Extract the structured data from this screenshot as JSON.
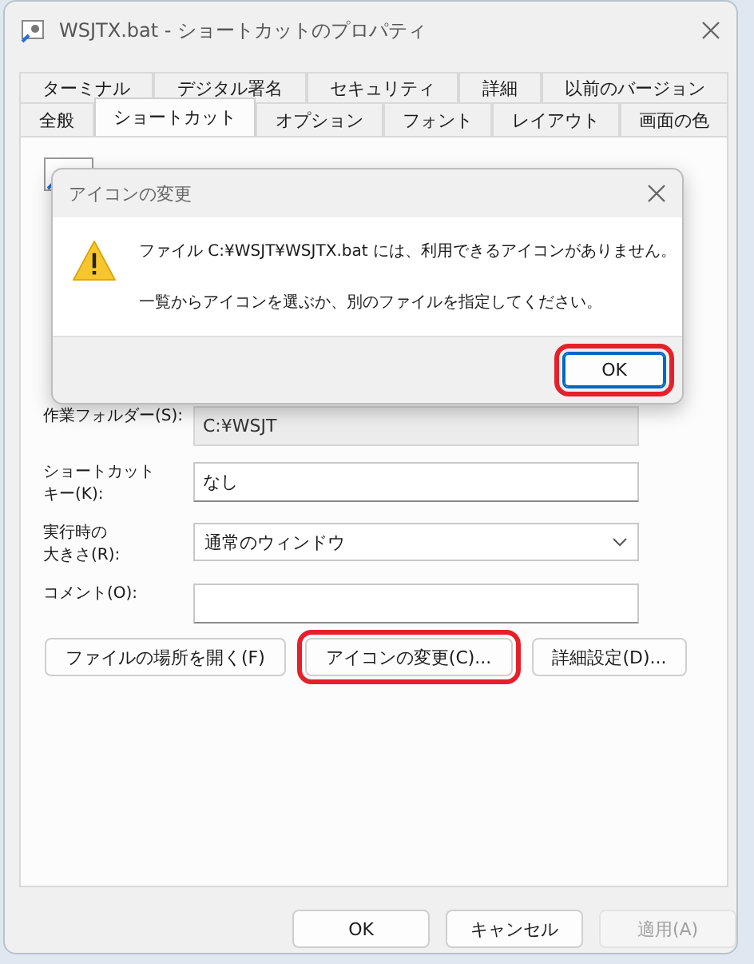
{
  "window": {
    "title": "WSJTX.bat - ショートカットのプロパティ"
  },
  "tab_rows": [
    [
      {
        "label": "ターミナル",
        "selected": false
      },
      {
        "label": "デジタル署名",
        "selected": false
      },
      {
        "label": "セキュリティ",
        "selected": false
      },
      {
        "label": "詳細",
        "selected": false
      },
      {
        "label": "以前のバージョン",
        "selected": false
      }
    ],
    [
      {
        "label": "全般",
        "selected": false
      },
      {
        "label": "ショートカット",
        "selected": true
      },
      {
        "label": "オプション",
        "selected": false
      },
      {
        "label": "フォント",
        "selected": false
      },
      {
        "label": "レイアウト",
        "selected": false
      },
      {
        "label": "画面の色",
        "selected": false
      }
    ]
  ],
  "fields": [
    {
      "kind": "text",
      "label_lines": [
        "作業フォルダー(S):"
      ],
      "value": "C:¥WSJT",
      "disabled": true
    },
    {
      "kind": "text",
      "label_lines": [
        "ショートカット",
        "キー(K):"
      ],
      "value": "なし",
      "disabled": false
    },
    {
      "kind": "dropdown",
      "label_lines": [
        "実行時の",
        "大きさ(R):"
      ],
      "value": "通常のウィンドウ",
      "disabled": false
    },
    {
      "kind": "text",
      "label_lines": [
        "コメント(O):"
      ],
      "disabled": false
    }
  ],
  "action_buttons": [
    {
      "label": "ファイルの場所を開く(F)",
      "highlighted": false
    },
    {
      "label": "アイコンの変更(C)...",
      "highlighted": true
    },
    {
      "label": "詳細設定(D)...",
      "highlighted": false
    }
  ],
  "footer_buttons": [
    {
      "label": "OK",
      "disabled": false
    },
    {
      "label": "キャンセル",
      "disabled": false
    },
    {
      "label": "適用(A)",
      "disabled": true
    }
  ],
  "dialog": {
    "title": "アイコンの変更",
    "messages": [
      "ファイル C:¥WSJT¥WSJTX.bat には、利用できるアイコンがありません。",
      "一覧からアイコンを選ぶか、別のファイルを指定してください。"
    ],
    "button": {
      "label": "OK",
      "highlighted": true
    }
  }
}
